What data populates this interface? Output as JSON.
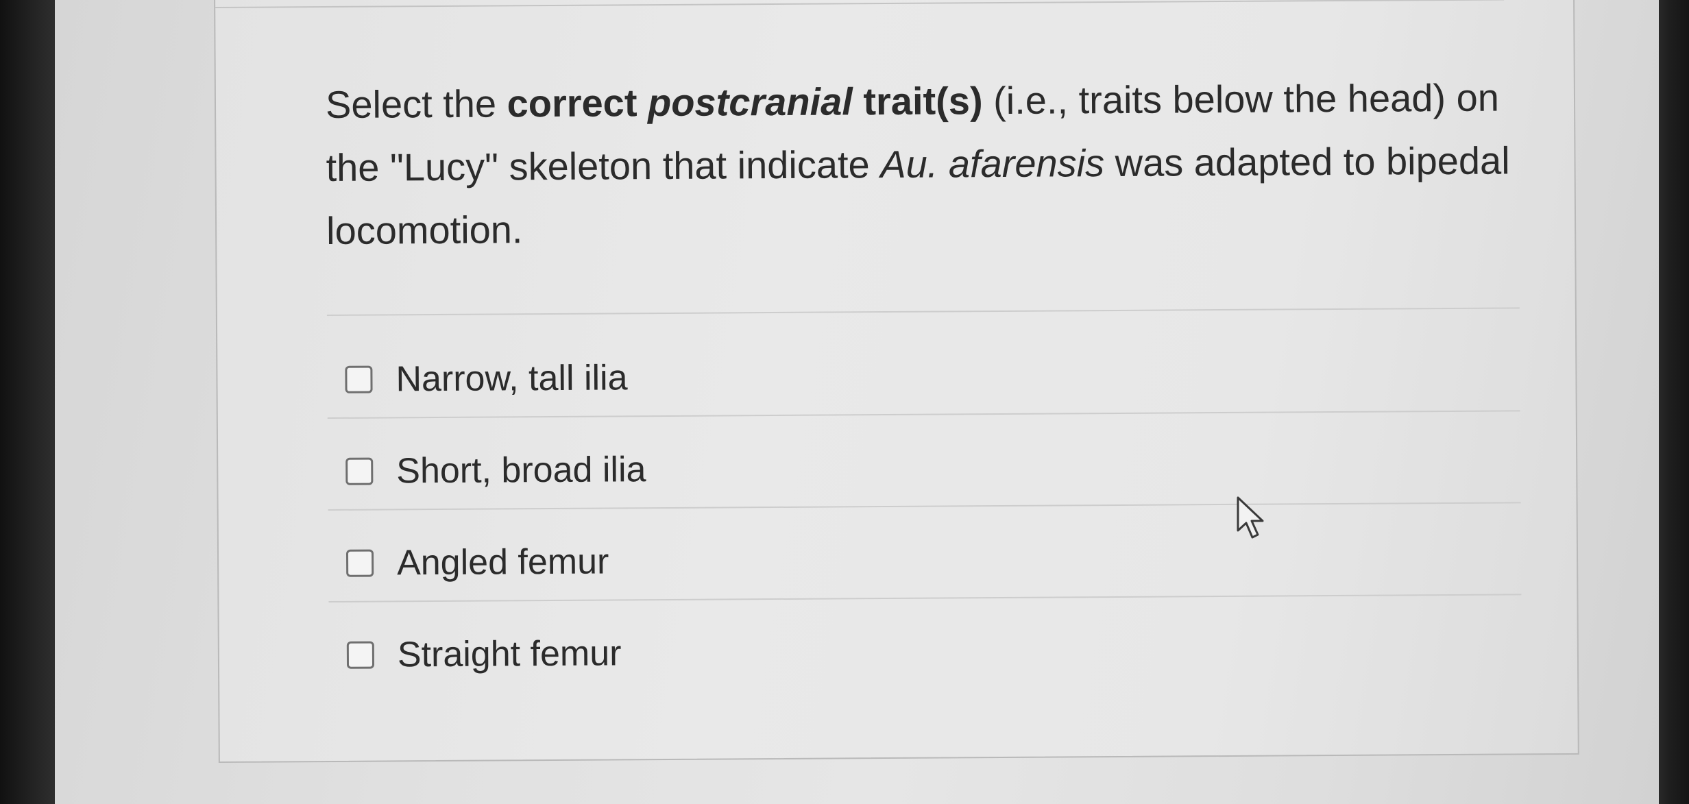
{
  "question": {
    "part1": "Select the ",
    "bold1": "correct ",
    "bold_italic": "postcranial",
    "bold2": " trait(s)",
    "part2": " (i.e., traits below the head) on the \"Lucy\" skeleton that indicate ",
    "italic": "Au. afarensis",
    "part3": " was adapted to bipedal locomotion."
  },
  "options": [
    {
      "label": "Narrow, tall ilia",
      "checked": false
    },
    {
      "label": "Short, broad ilia",
      "checked": false
    },
    {
      "label": "Angled femur",
      "checked": false
    },
    {
      "label": "Straight femur",
      "checked": false
    }
  ],
  "icons": {
    "checkbox": "checkbox-icon",
    "cursor": "mouse-pointer-icon"
  },
  "colors": {
    "text": "#2b2b2b",
    "checkbox_border": "#6f6f6f",
    "card_border": "#b9b9b9"
  }
}
